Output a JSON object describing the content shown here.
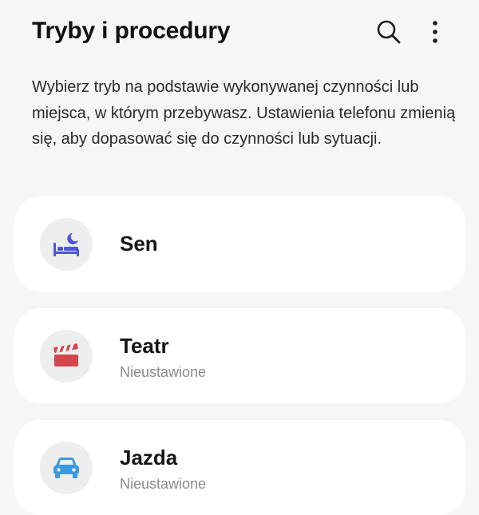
{
  "header": {
    "title": "Tryby i procedury",
    "search_icon": "search-icon",
    "more_icon": "more-vertical-icon"
  },
  "description": "Wybierz tryb na podstawie wykonywanej czynności lub miejsca, w którym przebywasz. Ustawienia telefonu zmienią się, aby dopasować się do czynności lub sytuacji.",
  "modes": [
    {
      "title": "Sen",
      "subtitle": "",
      "icon": "bed-moon-icon",
      "color": "#4b57d6"
    },
    {
      "title": "Teatr",
      "subtitle": "Nieustawione",
      "icon": "clapperboard-icon",
      "color": "#d4464a"
    },
    {
      "title": "Jazda",
      "subtitle": "Nieustawione",
      "icon": "car-icon",
      "color": "#3b9ae0"
    }
  ],
  "colors": {
    "background": "#f6f6f6",
    "card": "#ffffff",
    "icon_circle": "#eeeeef",
    "secondary_text": "#8a8a8a"
  }
}
